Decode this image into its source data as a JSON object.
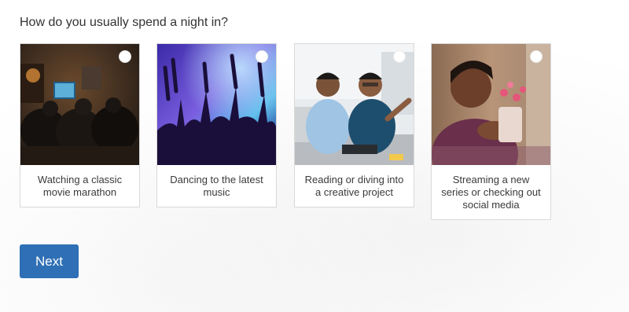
{
  "question": "How do you usually spend a night in?",
  "options": [
    {
      "label": "Watching a classic movie marathon",
      "selected": false
    },
    {
      "label": "Dancing to the latest music",
      "selected": false
    },
    {
      "label": "Reading or diving into a creative project",
      "selected": false
    },
    {
      "label": "Streaming a new series or checking out social media",
      "selected": false
    }
  ],
  "next_label": "Next",
  "colors": {
    "button": "#2f6fb5",
    "button_text": "#ffffff",
    "card_border": "#d9d9d9"
  }
}
